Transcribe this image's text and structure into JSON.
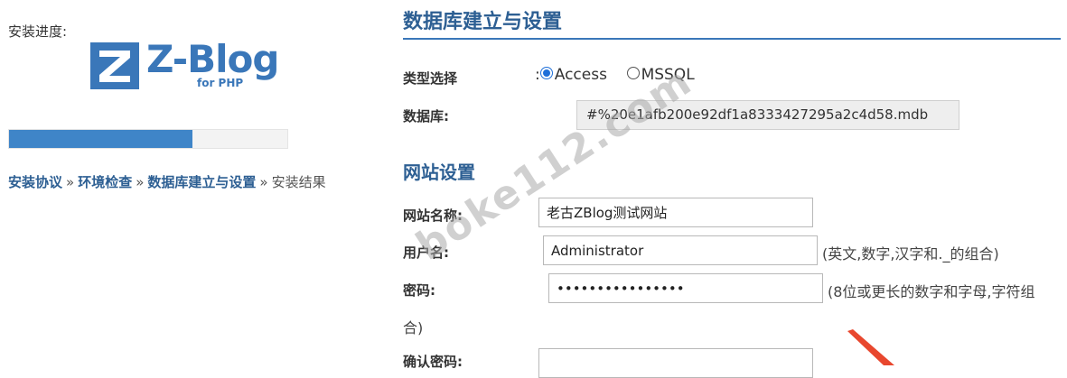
{
  "sidebar": {
    "progress_label": "安装进度:",
    "logo": {
      "name": "Z-Blog",
      "sub": "for PHP",
      "mark": "Z"
    },
    "progress_percent": 66,
    "steps": [
      {
        "label": "安装协议",
        "state": "done"
      },
      {
        "label": "环境检查",
        "state": "done"
      },
      {
        "label": "数据库建立与设置",
        "state": "done"
      },
      {
        "label": "安装结果",
        "state": "pending"
      }
    ],
    "separator": "»"
  },
  "main": {
    "title": "数据库建立与设置",
    "type_label": "类型选择",
    "type_prefix": ":",
    "type_options": [
      {
        "label": "Access",
        "checked": true
      },
      {
        "label": "MSSQL",
        "checked": false
      }
    ],
    "db_label": "数据库:",
    "db_value": "#%20e1afb200e92df1a8333427295a2c4d58.mdb",
    "site_settings_title": "网站设置",
    "site_name_label": "网站名称:",
    "site_name_value": "老古ZBlog测试网站",
    "username_label": "用户名:",
    "username_value": "Administrator",
    "username_hint": "(英文,数字,汉字和._的组合)",
    "password_label": "密码:",
    "password_value": "••••••••••••••••",
    "password_hint_line1": "(8位或更长的数字和字母,字符组",
    "password_hint_line2": "合)",
    "confirm_label": "确认密码:",
    "confirm_value": ""
  },
  "watermark": "boke112.com",
  "colors": {
    "accent": "#3a77b9",
    "heading": "#2d5f93",
    "arrow": "#e8472e"
  }
}
